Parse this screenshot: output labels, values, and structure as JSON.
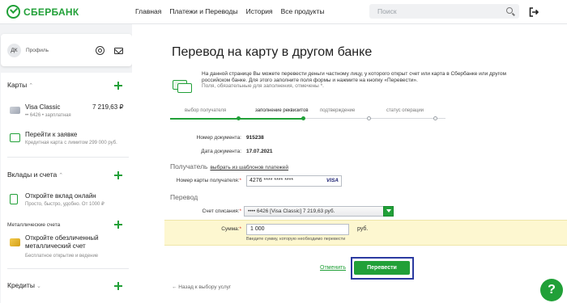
{
  "header": {
    "logo_text": "СБЕРБАНК",
    "nav": [
      "Главная",
      "Платежи и Переводы",
      "История",
      "Все продукты"
    ],
    "search_placeholder": "Поиск"
  },
  "profile": {
    "initials": "ДК",
    "label": "Профиль"
  },
  "sidebar": {
    "cards_title": "Карты",
    "card": {
      "name": "Visa Classic",
      "amount": "7 219,63 ₽",
      "sub": "•• 6426 • зарплатная"
    },
    "apply": {
      "title": "Перейти к заявке",
      "sub": "Кредитная карта с лимитом 299 000 руб."
    },
    "deposits_title": "Вклады и счета",
    "deposit": {
      "title": "Откройте вклад онлайн",
      "sub": "Просто, быстро, удобно. От 1000 ₽"
    },
    "metal_label": "Металлические счета",
    "metal": {
      "title": "Откройте обезличенный металлический счет",
      "sub": "Бесплатное открытие и ведение"
    },
    "credits_title": "Кредиты"
  },
  "main": {
    "title": "Перевод на карту в другом банке",
    "info": "На данной странице Вы можете перевести деньги частному лицу, у которого открыт счет или карта в Сбербанке или другом российском банке. Для этого заполните поля формы и нажмите на кнопку «Перевести».",
    "info_required": "Поля, обязательные для заполнения, отмечены *.",
    "steps": [
      "выбор получателя",
      "заполнение реквизитов",
      "подтверждение",
      "статус операции"
    ],
    "doc_number_label": "Номер документа:",
    "doc_number": "915238",
    "doc_date_label": "Дата документа:",
    "doc_date": "17.07.2021",
    "recipient_head": "Получатель",
    "template_link": "выбрать из шаблонов платежей",
    "card_number_label": "Номер карты получателя:",
    "card_number": "4276 **** **** ****",
    "card_brand": "VISA",
    "transfer_head": "Перевод",
    "debit_label": "Счет списания:",
    "debit_value": "•••• 6426 [Visa Classic] 7 219,63 руб.",
    "amount_label": "Сумма:",
    "amount_value": "1 000",
    "currency": "руб.",
    "amount_hint": "Введите сумму, которую необходимо перевести",
    "cancel": "Отменить",
    "submit": "Перевести",
    "back": "← Назад к выбору услуг"
  },
  "fab_icon": "help-chat-icon",
  "colors": {
    "accent": "#21a038",
    "highlight": "#fdf7d0",
    "frame": "#2b3aa0"
  }
}
